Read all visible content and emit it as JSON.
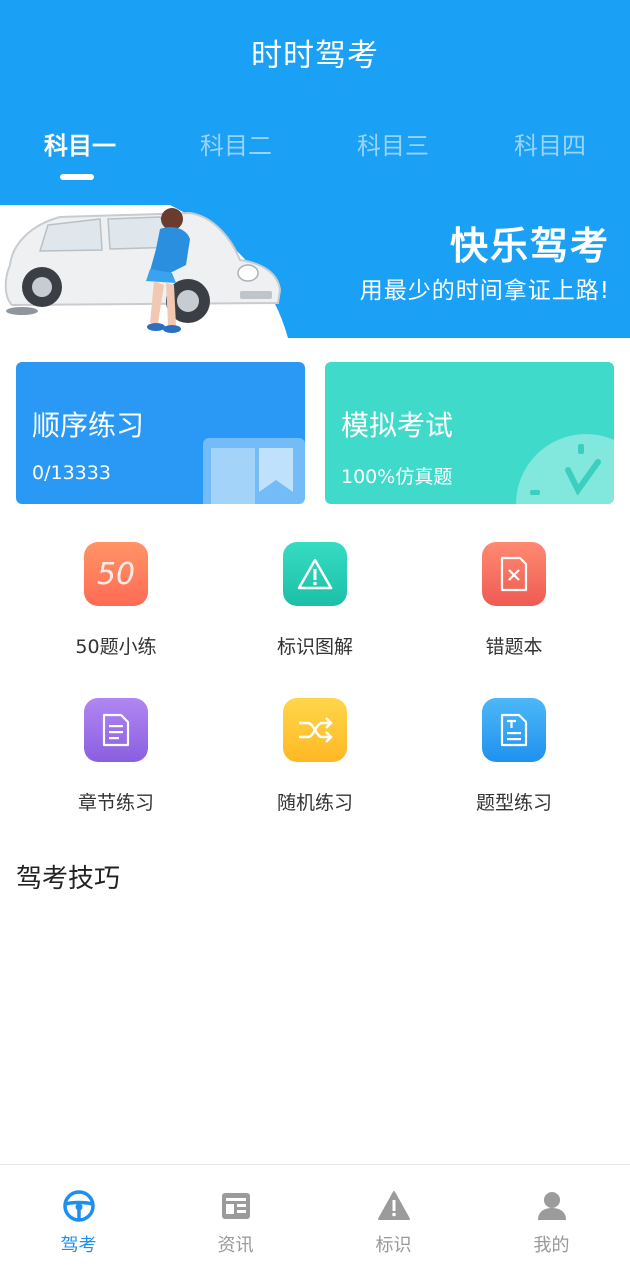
{
  "app": {
    "title": "时时驾考"
  },
  "tabs": [
    {
      "label": "科目一",
      "active": true
    },
    {
      "label": "科目二",
      "active": false
    },
    {
      "label": "科目三",
      "active": false
    },
    {
      "label": "科目四",
      "active": false
    }
  ],
  "banner": {
    "title": "快乐驾考",
    "subtitle": "用最少的时间拿证上路!"
  },
  "cards": {
    "sequential": {
      "title": "顺序练习",
      "progress": "0/13333",
      "icon": "book-bookmark-icon"
    },
    "mock_exam": {
      "title": "模拟考试",
      "subtitle": "100%仿真题",
      "icon": "clock-icon"
    }
  },
  "grid": [
    {
      "label": "50题小练",
      "icon": "fifty-icon",
      "color": "#ff7f5c"
    },
    {
      "label": "标识图解",
      "icon": "warning-sign-icon",
      "color": "#2ccfb6"
    },
    {
      "label": "错题本",
      "icon": "wrong-doc-icon",
      "color": "#f46a5e"
    },
    {
      "label": "章节练习",
      "icon": "document-icon",
      "color": "#9a6fe6"
    },
    {
      "label": "随机练习",
      "icon": "shuffle-icon",
      "color": "#ffc533"
    },
    {
      "label": "题型练习",
      "icon": "text-doc-icon",
      "color": "#2ea5f3"
    }
  ],
  "section": {
    "title": "驾考技巧"
  },
  "bottom_nav": [
    {
      "label": "驾考",
      "icon": "steering-wheel-icon",
      "active": true
    },
    {
      "label": "资讯",
      "icon": "news-icon",
      "active": false
    },
    {
      "label": "标识",
      "icon": "warning-icon",
      "active": false
    },
    {
      "label": "我的",
      "icon": "user-icon",
      "active": false
    }
  ],
  "colors": {
    "primary": "#1aa0f5",
    "nav_active": "#1e8ff0",
    "nav_inactive": "#9b9b9b"
  }
}
